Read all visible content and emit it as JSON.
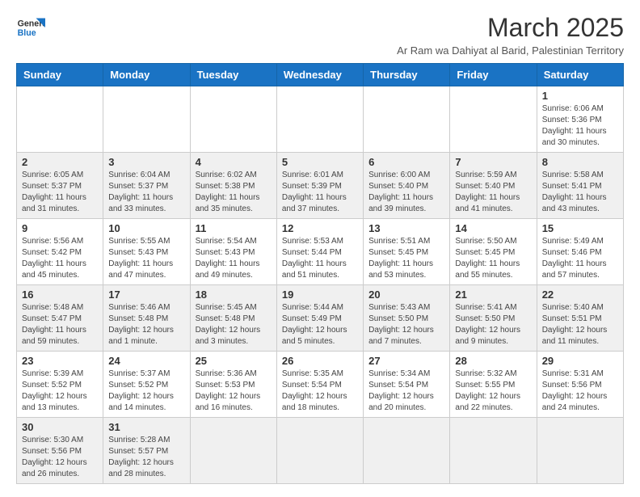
{
  "logo": {
    "line1": "General",
    "line2": "Blue"
  },
  "title": "March 2025",
  "subtitle": "Ar Ram wa Dahiyat al Barid, Palestinian Territory",
  "days_of_week": [
    "Sunday",
    "Monday",
    "Tuesday",
    "Wednesday",
    "Thursday",
    "Friday",
    "Saturday"
  ],
  "weeks": [
    [
      {
        "day": "",
        "info": ""
      },
      {
        "day": "",
        "info": ""
      },
      {
        "day": "",
        "info": ""
      },
      {
        "day": "",
        "info": ""
      },
      {
        "day": "",
        "info": ""
      },
      {
        "day": "",
        "info": ""
      },
      {
        "day": "1",
        "info": "Sunrise: 6:06 AM\nSunset: 5:36 PM\nDaylight: 11 hours and 30 minutes."
      }
    ],
    [
      {
        "day": "2",
        "info": "Sunrise: 6:05 AM\nSunset: 5:37 PM\nDaylight: 11 hours and 31 minutes."
      },
      {
        "day": "3",
        "info": "Sunrise: 6:04 AM\nSunset: 5:37 PM\nDaylight: 11 hours and 33 minutes."
      },
      {
        "day": "4",
        "info": "Sunrise: 6:02 AM\nSunset: 5:38 PM\nDaylight: 11 hours and 35 minutes."
      },
      {
        "day": "5",
        "info": "Sunrise: 6:01 AM\nSunset: 5:39 PM\nDaylight: 11 hours and 37 minutes."
      },
      {
        "day": "6",
        "info": "Sunrise: 6:00 AM\nSunset: 5:40 PM\nDaylight: 11 hours and 39 minutes."
      },
      {
        "day": "7",
        "info": "Sunrise: 5:59 AM\nSunset: 5:40 PM\nDaylight: 11 hours and 41 minutes."
      },
      {
        "day": "8",
        "info": "Sunrise: 5:58 AM\nSunset: 5:41 PM\nDaylight: 11 hours and 43 minutes."
      }
    ],
    [
      {
        "day": "9",
        "info": "Sunrise: 5:56 AM\nSunset: 5:42 PM\nDaylight: 11 hours and 45 minutes."
      },
      {
        "day": "10",
        "info": "Sunrise: 5:55 AM\nSunset: 5:43 PM\nDaylight: 11 hours and 47 minutes."
      },
      {
        "day": "11",
        "info": "Sunrise: 5:54 AM\nSunset: 5:43 PM\nDaylight: 11 hours and 49 minutes."
      },
      {
        "day": "12",
        "info": "Sunrise: 5:53 AM\nSunset: 5:44 PM\nDaylight: 11 hours and 51 minutes."
      },
      {
        "day": "13",
        "info": "Sunrise: 5:51 AM\nSunset: 5:45 PM\nDaylight: 11 hours and 53 minutes."
      },
      {
        "day": "14",
        "info": "Sunrise: 5:50 AM\nSunset: 5:45 PM\nDaylight: 11 hours and 55 minutes."
      },
      {
        "day": "15",
        "info": "Sunrise: 5:49 AM\nSunset: 5:46 PM\nDaylight: 11 hours and 57 minutes."
      }
    ],
    [
      {
        "day": "16",
        "info": "Sunrise: 5:48 AM\nSunset: 5:47 PM\nDaylight: 11 hours and 59 minutes."
      },
      {
        "day": "17",
        "info": "Sunrise: 5:46 AM\nSunset: 5:48 PM\nDaylight: 12 hours and 1 minute."
      },
      {
        "day": "18",
        "info": "Sunrise: 5:45 AM\nSunset: 5:48 PM\nDaylight: 12 hours and 3 minutes."
      },
      {
        "day": "19",
        "info": "Sunrise: 5:44 AM\nSunset: 5:49 PM\nDaylight: 12 hours and 5 minutes."
      },
      {
        "day": "20",
        "info": "Sunrise: 5:43 AM\nSunset: 5:50 PM\nDaylight: 12 hours and 7 minutes."
      },
      {
        "day": "21",
        "info": "Sunrise: 5:41 AM\nSunset: 5:50 PM\nDaylight: 12 hours and 9 minutes."
      },
      {
        "day": "22",
        "info": "Sunrise: 5:40 AM\nSunset: 5:51 PM\nDaylight: 12 hours and 11 minutes."
      }
    ],
    [
      {
        "day": "23",
        "info": "Sunrise: 5:39 AM\nSunset: 5:52 PM\nDaylight: 12 hours and 13 minutes."
      },
      {
        "day": "24",
        "info": "Sunrise: 5:37 AM\nSunset: 5:52 PM\nDaylight: 12 hours and 14 minutes."
      },
      {
        "day": "25",
        "info": "Sunrise: 5:36 AM\nSunset: 5:53 PM\nDaylight: 12 hours and 16 minutes."
      },
      {
        "day": "26",
        "info": "Sunrise: 5:35 AM\nSunset: 5:54 PM\nDaylight: 12 hours and 18 minutes."
      },
      {
        "day": "27",
        "info": "Sunrise: 5:34 AM\nSunset: 5:54 PM\nDaylight: 12 hours and 20 minutes."
      },
      {
        "day": "28",
        "info": "Sunrise: 5:32 AM\nSunset: 5:55 PM\nDaylight: 12 hours and 22 minutes."
      },
      {
        "day": "29",
        "info": "Sunrise: 5:31 AM\nSunset: 5:56 PM\nDaylight: 12 hours and 24 minutes."
      }
    ],
    [
      {
        "day": "30",
        "info": "Sunrise: 5:30 AM\nSunset: 5:56 PM\nDaylight: 12 hours and 26 minutes."
      },
      {
        "day": "31",
        "info": "Sunrise: 5:28 AM\nSunset: 5:57 PM\nDaylight: 12 hours and 28 minutes."
      },
      {
        "day": "",
        "info": ""
      },
      {
        "day": "",
        "info": ""
      },
      {
        "day": "",
        "info": ""
      },
      {
        "day": "",
        "info": ""
      },
      {
        "day": "",
        "info": ""
      }
    ]
  ]
}
